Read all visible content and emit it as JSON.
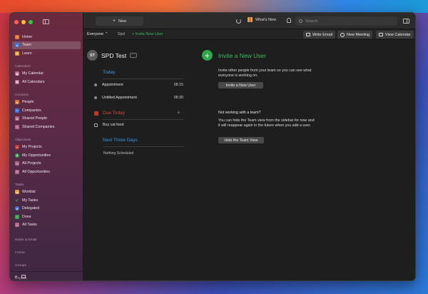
{
  "sidebar": {
    "top_items": [
      {
        "label": "Home",
        "icon": "home-icon",
        "color": "#e07a2f"
      },
      {
        "label": "Team",
        "icon": "team-icon",
        "color": "#3a7de0"
      },
      {
        "label": "Learn",
        "icon": "learn-icon",
        "color": "#e0a23b"
      }
    ],
    "calendars_head": "Calendars",
    "calendars": [
      {
        "label": "My Calendar",
        "icon": "calendar-icon",
        "color": "#b36a8b"
      },
      {
        "label": "All Calendars",
        "icon": "calendars-icon",
        "color": "#b36a8b"
      }
    ],
    "contacts_head": "Contacts",
    "contacts": [
      {
        "label": "People",
        "icon": "person-icon",
        "color": "#e07a2f"
      },
      {
        "label": "Companies",
        "icon": "company-icon",
        "color": "#3a7de0"
      },
      {
        "label": "Shared People",
        "icon": "shared-people-icon",
        "color": "#b36a8b"
      },
      {
        "label": "Shared Companies",
        "icon": "shared-companies-icon",
        "color": "#b36a8b"
      }
    ],
    "objectives_head": "Objectives",
    "objectives": [
      {
        "label": "My Projects",
        "icon": "projects-icon",
        "color": "#c3352f"
      },
      {
        "label": "My Opportunities",
        "icon": "opportunities-icon",
        "color": "#2ea84a"
      },
      {
        "label": "All Projects",
        "icon": "all-projects-icon",
        "color": "#b36a8b"
      },
      {
        "label": "All Opportunities",
        "icon": "all-opportunities-icon",
        "color": "#b36a8b"
      }
    ],
    "tasks_head": "Tasks",
    "tasks": [
      {
        "label": "Worklist",
        "icon": "worklist-icon",
        "color": "#e0a23b"
      },
      {
        "label": "My Tasks",
        "icon": "checkmark-icon",
        "color": "#2ea84a"
      },
      {
        "label": "Delegated",
        "icon": "delegated-icon",
        "color": "#3a7de0"
      },
      {
        "label": "Done",
        "icon": "done-icon",
        "color": "#2ea84a"
      },
      {
        "label": "All Tasks",
        "icon": "all-tasks-icon",
        "color": "#b36a8b"
      }
    ],
    "notes_head": "Notes & Email",
    "forms_head": "Forms",
    "groups_head": "Groups",
    "reports_head": "Reports"
  },
  "titlebar": {
    "new_label": "New",
    "whats_new": "What's New",
    "search_placeholder": "Search"
  },
  "toolbar": {
    "everyone": "Everyone",
    "spd": "Spd",
    "invite": "Invite New User",
    "write_email": "Write Email",
    "new_meeting": "New Meeting",
    "view_calendar": "View Calendar"
  },
  "user": {
    "initials": "ST",
    "name": "SPD Test"
  },
  "today": {
    "title": "Today",
    "items": [
      {
        "label": "Appointment",
        "time": "08:15"
      },
      {
        "label": "Untitled Appointment",
        "time": "08:30"
      }
    ]
  },
  "due_today": {
    "title": "Due Today",
    "items": [
      {
        "label": "Buy cat food"
      }
    ]
  },
  "next_three": {
    "title": "Next Three Days",
    "empty": "Nothing Scheduled"
  },
  "invite_panel": {
    "title": "Invite a New User",
    "description": "Invite other people from your team so you can see what everyone is working on.",
    "button": "Invite a New User",
    "no_team_title": "Not working with a team?",
    "no_team_text": "You can hide the Team view from the sidebar for now and it will reappear again in the future when you add a user.",
    "hide_button": "Hide the Team View"
  },
  "colors": {
    "accent_blue": "#3a9ae8",
    "accent_red": "#d9453c",
    "accent_green": "#3bbd5a"
  }
}
